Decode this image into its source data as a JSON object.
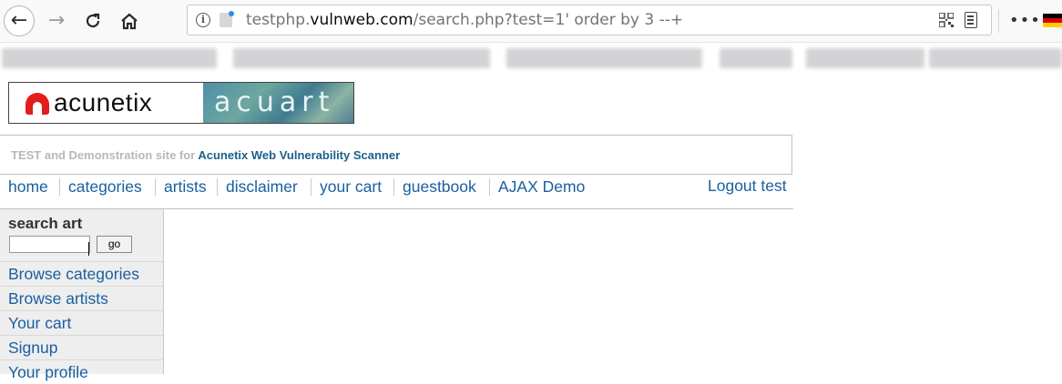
{
  "browser": {
    "url_prefix": "testphp.",
    "url_host": "vulnweb.com",
    "url_path": "/search.php?test=1' order by 3 --+",
    "info_symbol": "i",
    "menu_symbol": "•••",
    "flag_colors": [
      "#000000",
      "#dd0000",
      "#ffce00"
    ]
  },
  "site": {
    "logo_text": "acunetix",
    "logo_sub": "acuart",
    "tagline_prefix": "TEST and Demonstration site for ",
    "tagline_brand": "Acunetix Web Vulnerability Scanner",
    "brand_color": "#1c5f8c",
    "link_color": "#1a5fa0"
  },
  "menu": {
    "items": [
      "home",
      "categories",
      "artists",
      "disclaimer",
      "your cart",
      "guestbook",
      "AJAX Demo"
    ],
    "logout": "Logout test"
  },
  "sidebar": {
    "search_title": "search art",
    "search_value": "",
    "go_label": "go",
    "links": [
      "Browse categories",
      "Browse artists",
      "Your cart",
      "Signup",
      "Your profile"
    ]
  }
}
